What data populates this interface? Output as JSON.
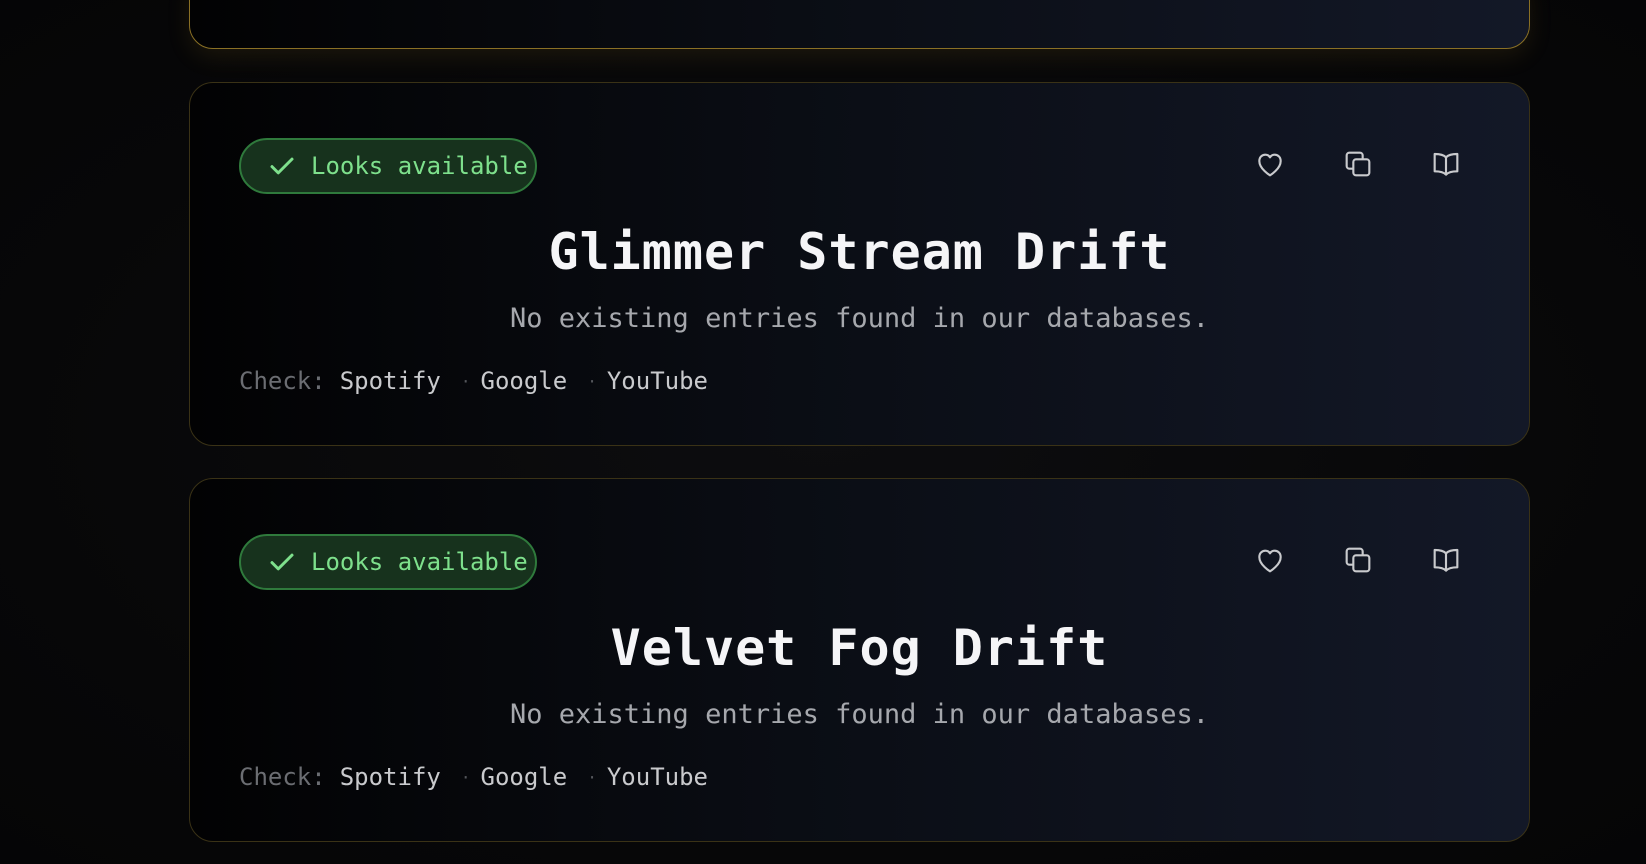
{
  "cards": [
    {
      "badge": "Looks available",
      "title": "Glimmer Stream Drift",
      "subtitle": "No existing entries found in our databases.",
      "check_prefix": "Check:",
      "links": [
        "Spotify",
        "Google",
        "YouTube"
      ]
    },
    {
      "badge": "Looks available",
      "title": "Velvet Fog Drift",
      "subtitle": "No existing entries found in our databases.",
      "check_prefix": "Check:",
      "links": [
        "Spotify",
        "Google",
        "YouTube"
      ]
    }
  ],
  "separator": "·",
  "icons": {
    "badge": "check-icon",
    "actions": [
      "heart-icon",
      "copy-icon",
      "book-icon"
    ]
  },
  "colors": {
    "available_text": "#7ee08c",
    "available_bg": "#17321d",
    "card_border": "#3a3216",
    "highlight_border": "#8a7025"
  }
}
